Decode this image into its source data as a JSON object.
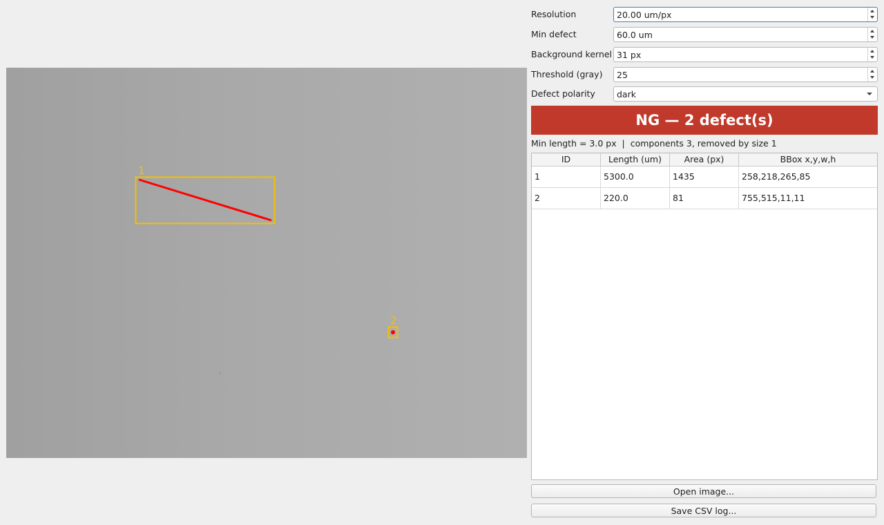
{
  "viewer": {
    "markers": [
      {
        "label": "1",
        "box_color": "#f5c000",
        "line_color": "#ff0000"
      },
      {
        "label": "2",
        "box_color": "#f5c000",
        "dot_color": "#ff0000"
      }
    ]
  },
  "settings": {
    "resolution": {
      "label": "Resolution",
      "value": "20.00 um/px"
    },
    "min_defect": {
      "label": "Min defect",
      "value": "60.0 um"
    },
    "background_kernel": {
      "label": "Background kernel",
      "value": "31 px"
    },
    "threshold": {
      "label": "Threshold (gray)",
      "value": "25"
    },
    "polarity": {
      "label": "Defect polarity",
      "value": "dark"
    }
  },
  "status": {
    "text": "NG — 2 defect(s)",
    "color": "#c0392b"
  },
  "summary": "Min length = 3.0 px  |  components 3, removed by size 1",
  "table": {
    "headers": [
      "ID",
      "Length (um)",
      "Area (px)",
      "BBox x,y,w,h"
    ],
    "rows": [
      [
        "1",
        "5300.0",
        "1435",
        "258,218,265,85"
      ],
      [
        "2",
        "220.0",
        "81",
        "755,515,11,11"
      ]
    ]
  },
  "buttons": {
    "open_image": "Open image...",
    "save_csv": "Save CSV log..."
  }
}
